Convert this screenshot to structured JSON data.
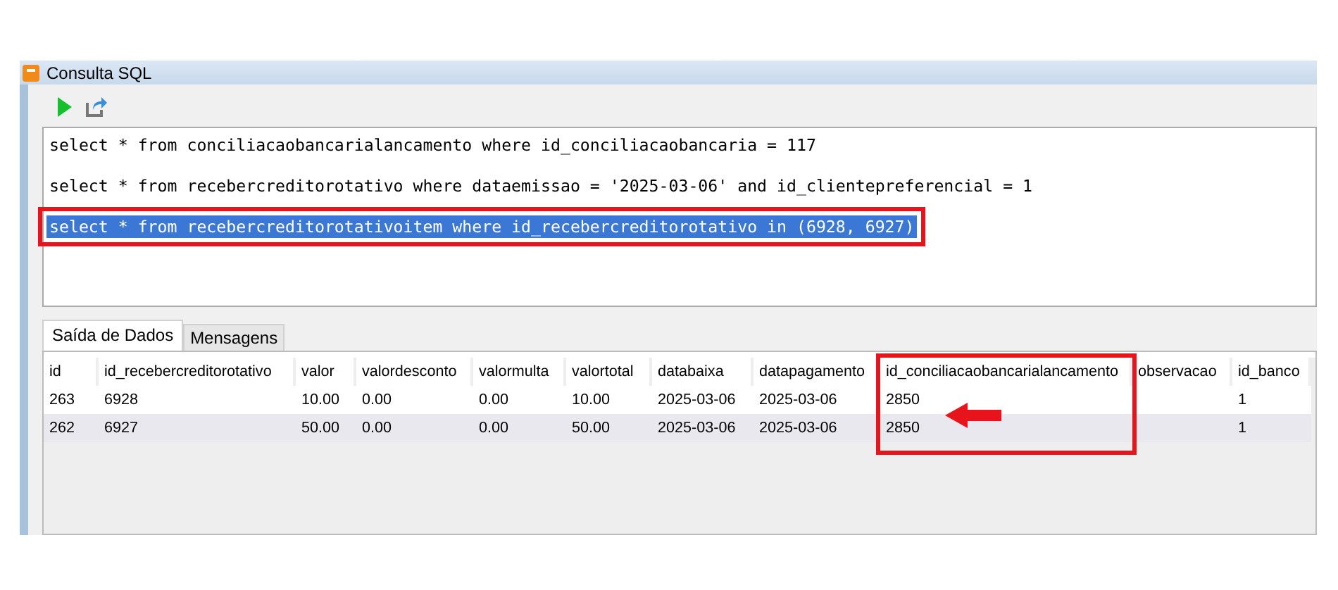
{
  "window": {
    "title": "Consulta SQL"
  },
  "editor": {
    "lines": [
      {
        "text": "select * from conciliacaobancarialancamento where id_conciliacaobancaria = 117",
        "selected": false,
        "highlighted": false
      },
      {
        "text": "select * from recebercreditorotativo where dataemissao = '2025-03-06' and id_clientepreferencial = 1",
        "selected": false,
        "highlighted": false
      },
      {
        "text": "select * from recebercreditorotativoitem where id_recebercreditorotativo in (6928, 6927)",
        "selected": true,
        "highlighted": true
      }
    ]
  },
  "tabs": [
    {
      "label": "Saída de Dados",
      "selected": true
    },
    {
      "label": "Mensagens",
      "selected": false
    }
  ],
  "table": {
    "columns": [
      {
        "label": "id",
        "highlighted": false
      },
      {
        "label": "id_recebercreditorotativo",
        "highlighted": false
      },
      {
        "label": "valor",
        "highlighted": false
      },
      {
        "label": "valordesconto",
        "highlighted": false
      },
      {
        "label": "valormulta",
        "highlighted": false
      },
      {
        "label": "valortotal",
        "highlighted": false
      },
      {
        "label": "databaixa",
        "highlighted": false
      },
      {
        "label": "datapagamento",
        "highlighted": false
      },
      {
        "label": "id_conciliacaobancarialancamento",
        "highlighted": true
      },
      {
        "label": "observacao",
        "highlighted": false
      },
      {
        "label": "id_banco",
        "highlighted": false
      }
    ],
    "rows": [
      [
        "263",
        "6928",
        "10.00",
        "0.00",
        "0.00",
        "10.00",
        "2025-03-06",
        "2025-03-06",
        "2850",
        "",
        "1"
      ],
      [
        "262",
        "6927",
        "50.00",
        "0.00",
        "0.00",
        "50.00",
        "2025-03-06",
        "2025-03-06",
        "2850",
        "",
        "1"
      ]
    ]
  }
}
